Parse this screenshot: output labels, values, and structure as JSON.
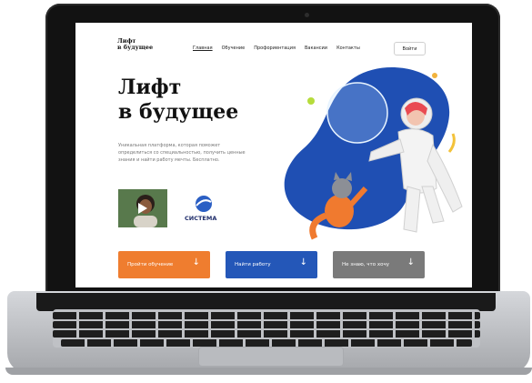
{
  "header": {
    "logo_line1": "Лифт",
    "logo_line2": "в будущее",
    "nav": [
      "Главная",
      "Обучение",
      "Профориентация",
      "Вакансии",
      "Контакты"
    ],
    "login": "Войти"
  },
  "hero": {
    "title_line1": "Лифт",
    "title_line2": "в будущее",
    "description": "Уникальная платформа, которая поможет определиться со специальностью, получить ценные знания и найти работу мечты. Бесплатно."
  },
  "partner": {
    "name": "СИСТЕМА"
  },
  "cta": {
    "learn": "Пройти обучение",
    "job": "Найти работу",
    "unknown": "Не знаю, что хочу",
    "arrow": "↓"
  },
  "colors": {
    "orange": "#ef7d2f",
    "blue": "#2457b8",
    "gray": "#7a7a7a",
    "art_blue": "#1f4fb3"
  },
  "icons": {
    "play": "play-icon",
    "partner_logo": "sistema-logo-icon",
    "arrow": "arrow-down-icon"
  }
}
